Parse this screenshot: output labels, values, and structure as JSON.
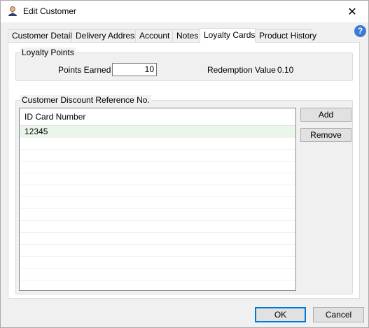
{
  "window": {
    "title": "Edit Customer",
    "icon": "user-icon",
    "close_icon": "close-icon"
  },
  "help_icon": "help-icon",
  "tabs": [
    {
      "label": "Customer Details"
    },
    {
      "label": "Delivery Address"
    },
    {
      "label": "Account"
    },
    {
      "label": "Notes"
    },
    {
      "label": "Loyalty Cards",
      "active": true
    },
    {
      "label": "Product History"
    }
  ],
  "loyalty_points": {
    "group_label": "Loyalty Points",
    "points_earned_label": "Points Earned",
    "points_earned_value": "10",
    "redemption_label": "Redemption Value",
    "redemption_value": "0.10"
  },
  "discount_reference": {
    "group_label": "Customer Discount Reference No.",
    "column_header": "ID Card Number",
    "rows": [
      "12345"
    ],
    "add_label": "Add",
    "remove_label": "Remove"
  },
  "footer": {
    "ok_label": "OK",
    "cancel_label": "Cancel"
  }
}
